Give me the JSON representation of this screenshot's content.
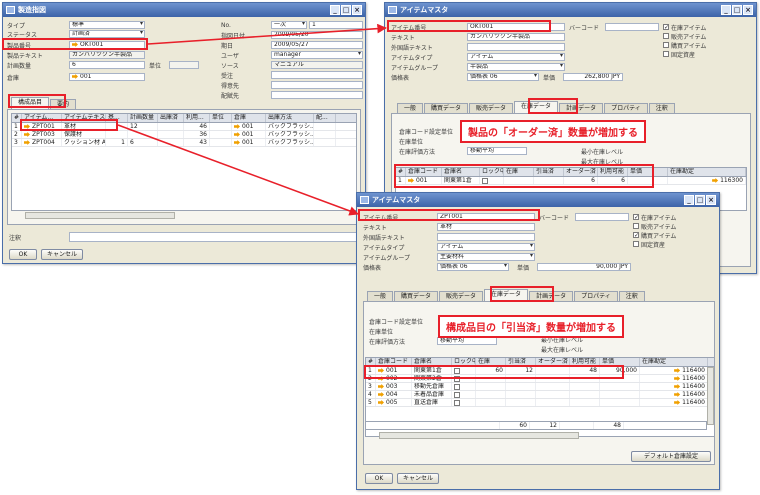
{
  "win1": {
    "title": "製造指図",
    "left_fields": [
      {
        "label": "タイプ",
        "value": "標準"
      },
      {
        "label": "ステータス",
        "value": "計画済"
      },
      {
        "label": "製品番号",
        "value": "OKT001"
      },
      {
        "label": "製品テキスト",
        "value": "カンバリツクン半製品"
      },
      {
        "label": "計画数量",
        "value": "6",
        "extra_label": "単位"
      },
      {
        "label": "倉庫",
        "value": "001"
      }
    ],
    "right_fields": [
      {
        "label": "No.",
        "value": "一次",
        "value2": "1"
      },
      {
        "label": "指図日付",
        "value": "2009/05/20"
      },
      {
        "label": "期日",
        "value": "2009/05/27"
      },
      {
        "label": "ユーザ",
        "value": "manager"
      },
      {
        "label": "ソース",
        "value": "マニュアル"
      },
      {
        "label": "受注",
        "value": ""
      },
      {
        "label": "得意先",
        "value": ""
      },
      {
        "label": "配賦先",
        "value": ""
      }
    ],
    "tabs": [
      "構成品目",
      "要約"
    ],
    "grid_headers": [
      "#",
      "アイテム...",
      "アイテムテキスト",
      "基...",
      "計画数量",
      "出庫済",
      "利用...",
      "単位",
      "倉庫",
      "出庫方法",
      "配..."
    ],
    "grid_rows": [
      {
        "no": "1",
        "item": "ZPT001",
        "text": "革材",
        "base": "",
        "planned": "12",
        "issued": "",
        "avail": "46",
        "unit": "",
        "wh": "001",
        "method": "バックフラッシ..."
      },
      {
        "no": "2",
        "item": "ZPT003",
        "text": "保護材",
        "base": "",
        "planned": "",
        "issued": "",
        "avail": "36",
        "unit": "",
        "wh": "001",
        "method": "バックフラッシ..."
      },
      {
        "no": "3",
        "item": "ZPT004",
        "text": "クッション材 A",
        "base": "1",
        "planned": "6",
        "issued": "",
        "avail": "43",
        "unit": "",
        "wh": "001",
        "method": "バックフラッシ..."
      }
    ],
    "remarks_label": "注釈",
    "ok_label": "OK",
    "cancel_label": "キャンセル"
  },
  "win2": {
    "title": "アイテムマスタ",
    "fields": [
      {
        "label": "アイテム番号",
        "value": "OKT001"
      },
      {
        "label": "テキスト",
        "value": "カンバリツクン半製品"
      },
      {
        "label": "外国語テキスト",
        "value": ""
      },
      {
        "label": "アイテムタイプ",
        "value": "アイテム"
      },
      {
        "label": "アイテムグループ",
        "value": "半製品"
      },
      {
        "label": "価格表",
        "value": "価格表 06"
      }
    ],
    "barcode_label": "バーコード",
    "price_label": "単価",
    "price_value": "262,800 JPY",
    "checkboxes": [
      {
        "label": "在庫アイテム",
        "checked": "✓"
      },
      {
        "label": "販売アイテム",
        "checked": ""
      },
      {
        "label": "購買アイテム",
        "checked": ""
      },
      {
        "label": "固定資産",
        "checked": ""
      }
    ],
    "tabs": [
      "一般",
      "購買データ",
      "販売データ",
      "在庫データ",
      "計画データ",
      "プロパティ",
      "注釈"
    ],
    "inv_fields": [
      {
        "label": "倉庫コード設定単位"
      },
      {
        "label": "在庫単位"
      },
      {
        "label": "在庫評価方法",
        "value": "移動平均"
      }
    ],
    "min_label": "最小在庫レベル",
    "max_label": "最大在庫レベル",
    "grid_headers": [
      "#",
      "倉庫コード",
      "倉庫名",
      "ロック中",
      "在庫",
      "引当済",
      "オーダー済",
      "利用可能",
      "単価",
      "在庫勘定"
    ],
    "grid_row": {
      "no": "1",
      "code": "001",
      "name": "関東第1倉",
      "ordered": "6",
      "avail": "6",
      "account": "116300"
    },
    "callout": "製品の「オーダー済」数量が増加する"
  },
  "win3": {
    "title": "アイテムマスタ",
    "fields": [
      {
        "label": "アイテム番号",
        "value": "ZPT001"
      },
      {
        "label": "テキスト",
        "value": "革材"
      },
      {
        "label": "外国語テキスト",
        "value": ""
      },
      {
        "label": "アイテムタイプ",
        "value": "アイテム"
      },
      {
        "label": "アイテムグループ",
        "value": "主要材料"
      },
      {
        "label": "価格表",
        "value": "価格表 06"
      }
    ],
    "barcode_label": "バーコード",
    "price_label": "単価",
    "price_value": "90,000 JPY",
    "checkboxes": [
      {
        "label": "在庫アイテム",
        "checked": "✓"
      },
      {
        "label": "販売アイテム",
        "checked": ""
      },
      {
        "label": "購買アイテム",
        "checked": "✓"
      },
      {
        "label": "固定資産",
        "checked": ""
      }
    ],
    "tabs": [
      "一般",
      "購買データ",
      "販売データ",
      "在庫データ",
      "計画データ",
      "プロパティ",
      "注釈"
    ],
    "inv_fields": [
      {
        "label": "倉庫コード設定単位"
      },
      {
        "label": "在庫単位"
      },
      {
        "label": "在庫評価方法",
        "value": "移動平均"
      }
    ],
    "min_label": "最小在庫レベル",
    "max_label": "最大在庫レベル",
    "grid_headers": [
      "#",
      "倉庫コード",
      "倉庫名",
      "ロック中",
      "在庫",
      "引当済",
      "オーダー済",
      "利用可能",
      "単価",
      "在庫勘定"
    ],
    "grid_rows": [
      {
        "no": "1",
        "code": "001",
        "name": "関東第1倉",
        "stock": "60",
        "committed": "12",
        "ordered": "",
        "avail": "48",
        "price": "90,000",
        "account": "116400"
      },
      {
        "no": "2",
        "code": "002",
        "name": "関東第2倉",
        "stock": "",
        "committed": "",
        "ordered": "",
        "avail": "",
        "price": "",
        "account": "116400"
      },
      {
        "no": "3",
        "code": "003",
        "name": "移動先倉庫",
        "stock": "",
        "committed": "",
        "ordered": "",
        "avail": "",
        "price": "",
        "account": "116400"
      },
      {
        "no": "4",
        "code": "004",
        "name": "未着品倉庫",
        "stock": "",
        "committed": "",
        "ordered": "",
        "avail": "",
        "price": "",
        "account": "116400"
      },
      {
        "no": "5",
        "code": "005",
        "name": "直送倉庫",
        "stock": "",
        "committed": "",
        "ordered": "",
        "avail": "",
        "price": "",
        "account": "116400"
      }
    ],
    "totals": {
      "stock": "60",
      "committed": "12",
      "avail": "48"
    },
    "default_wh_button": "デフォルト倉庫設定",
    "ok_label": "OK",
    "cancel_label": "キャンセル",
    "callout": "構成品目の「引当済」数量が増加する"
  }
}
